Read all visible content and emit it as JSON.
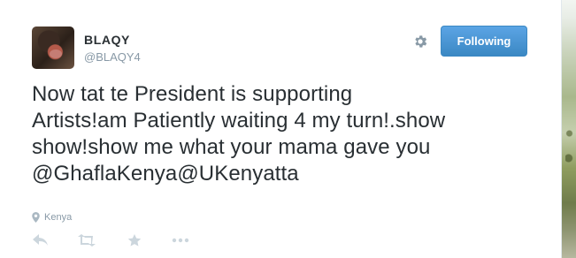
{
  "profile": {
    "name": "BLAQY",
    "handle": "@BLAQY4",
    "avatar_icon": "avatar-photo"
  },
  "header": {
    "settings_icon": "gear-icon",
    "follow_button_label": "Following",
    "follow_button_color": "#4a90d9"
  },
  "tweet": {
    "lines": [
      "Now tat te President is supporting",
      "Artists!am Patiently waiting 4 my turn!.show",
      "show!show me what your mama gave you",
      "@GhaflaKenya@UKenyatta"
    ]
  },
  "location": {
    "icon": "location-pin-icon",
    "label": "Kenya"
  },
  "actions": {
    "reply_icon": "reply-icon",
    "retweet_icon": "retweet-icon",
    "favorite_icon": "star-icon",
    "more_icon": "more-icon"
  },
  "colors": {
    "text": "#292f33",
    "muted": "#8899a6",
    "icon": "#ccd6dd"
  }
}
